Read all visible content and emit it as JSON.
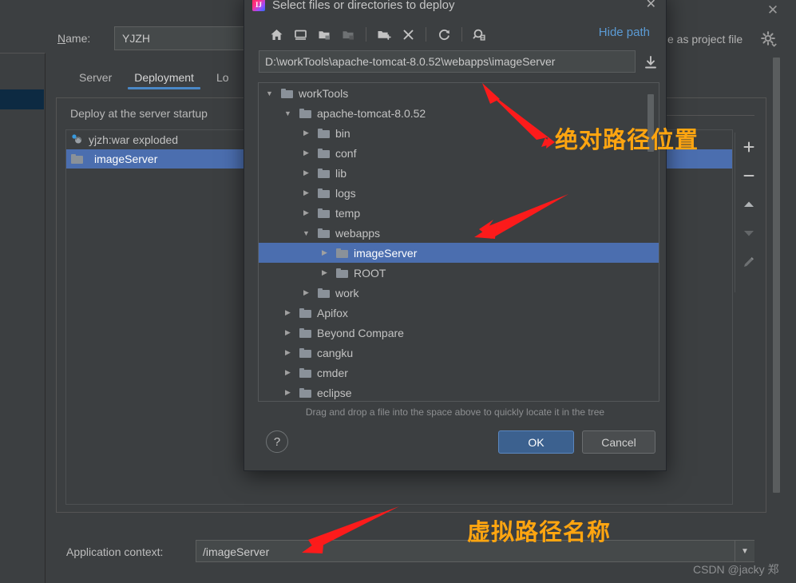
{
  "background_dialog": {
    "close_icon": "✕",
    "name_label_prefix": "N",
    "name_label_rest": "ame:",
    "name_value": "YJZH",
    "store_label": "e as project file",
    "gear_icon": "gear-icon",
    "tabs": [
      {
        "label": "Server",
        "active": false
      },
      {
        "label": "Deployment",
        "active": true
      },
      {
        "label": "Lo",
        "active": false
      }
    ],
    "deploy_group_legend": "Deploy at the server startup",
    "deploy_items": [
      {
        "label": "yjzh:war exploded",
        "icon": "artifact-icon",
        "selected": false
      },
      {
        "label": "imageServer",
        "icon": "folder-icon",
        "selected": true
      }
    ],
    "side_tools": [
      {
        "name": "add-button",
        "glyph": "+",
        "enabled": true
      },
      {
        "name": "remove-button",
        "glyph": "−",
        "enabled": true
      },
      {
        "name": "move-up-button",
        "glyph": "▲",
        "enabled": true
      },
      {
        "name": "move-down-button",
        "glyph": "▼",
        "enabled": false
      },
      {
        "name": "edit-button",
        "glyph": "✎",
        "enabled": false
      }
    ],
    "app_context_label": "Application context:",
    "app_context_value": "/imageServer",
    "app_context_dropdown_icon": "▼"
  },
  "chooser_dialog": {
    "app_icon_letter": "IJ",
    "title": "Select files or directories to deploy",
    "close_icon": "✕",
    "hide_path_label": "Hide path",
    "toolbar": [
      {
        "name": "home-icon",
        "enabled": true
      },
      {
        "name": "desktop-icon",
        "enabled": true
      },
      {
        "name": "expand-all-icon",
        "enabled": true
      },
      {
        "name": "collapse-all-icon",
        "enabled": false
      },
      {
        "name": "new-folder-icon",
        "enabled": true
      },
      {
        "name": "delete-icon",
        "enabled": true
      },
      {
        "name": "refresh-icon",
        "enabled": true
      },
      {
        "name": "show-hidden-icon",
        "enabled": true
      }
    ],
    "path_value": "D:\\workTools\\apache-tomcat-8.0.52\\webapps\\imageServer",
    "path_download_icon": "download-icon",
    "tree": [
      {
        "label": "workTools",
        "depth": 1,
        "state": "expanded",
        "selected": false
      },
      {
        "label": "apache-tomcat-8.0.52",
        "depth": 2,
        "state": "expanded",
        "selected": false
      },
      {
        "label": "bin",
        "depth": 3,
        "state": "collapsed",
        "selected": false
      },
      {
        "label": "conf",
        "depth": 3,
        "state": "collapsed",
        "selected": false
      },
      {
        "label": "lib",
        "depth": 3,
        "state": "collapsed",
        "selected": false
      },
      {
        "label": "logs",
        "depth": 3,
        "state": "collapsed",
        "selected": false
      },
      {
        "label": "temp",
        "depth": 3,
        "state": "collapsed",
        "selected": false
      },
      {
        "label": "webapps",
        "depth": 3,
        "state": "expanded",
        "selected": false
      },
      {
        "label": "imageServer",
        "depth": 4,
        "state": "collapsed",
        "selected": true
      },
      {
        "label": "ROOT",
        "depth": 4,
        "state": "collapsed",
        "selected": false
      },
      {
        "label": "work",
        "depth": 3,
        "state": "collapsed",
        "selected": false
      },
      {
        "label": "Apifox",
        "depth": 2,
        "state": "collapsed",
        "selected": false
      },
      {
        "label": "Beyond Compare",
        "depth": 2,
        "state": "collapsed",
        "selected": false
      },
      {
        "label": "cangku",
        "depth": 2,
        "state": "collapsed",
        "selected": false
      },
      {
        "label": "cmder",
        "depth": 2,
        "state": "collapsed",
        "selected": false
      },
      {
        "label": "eclipse",
        "depth": 2,
        "state": "collapsed",
        "selected": false
      }
    ],
    "hint": "Drag and drop a file into the space above to quickly locate it in the tree",
    "help_label": "?",
    "ok_label": "OK",
    "cancel_label": "Cancel"
  },
  "annotations": {
    "absolute_path_note": "绝对路径位置",
    "virtual_path_note": "虚拟路径名称",
    "arrow_color": "#fc1b1b",
    "note_color": "#ffa510"
  },
  "watermark": "CSDN @jacky 郑"
}
